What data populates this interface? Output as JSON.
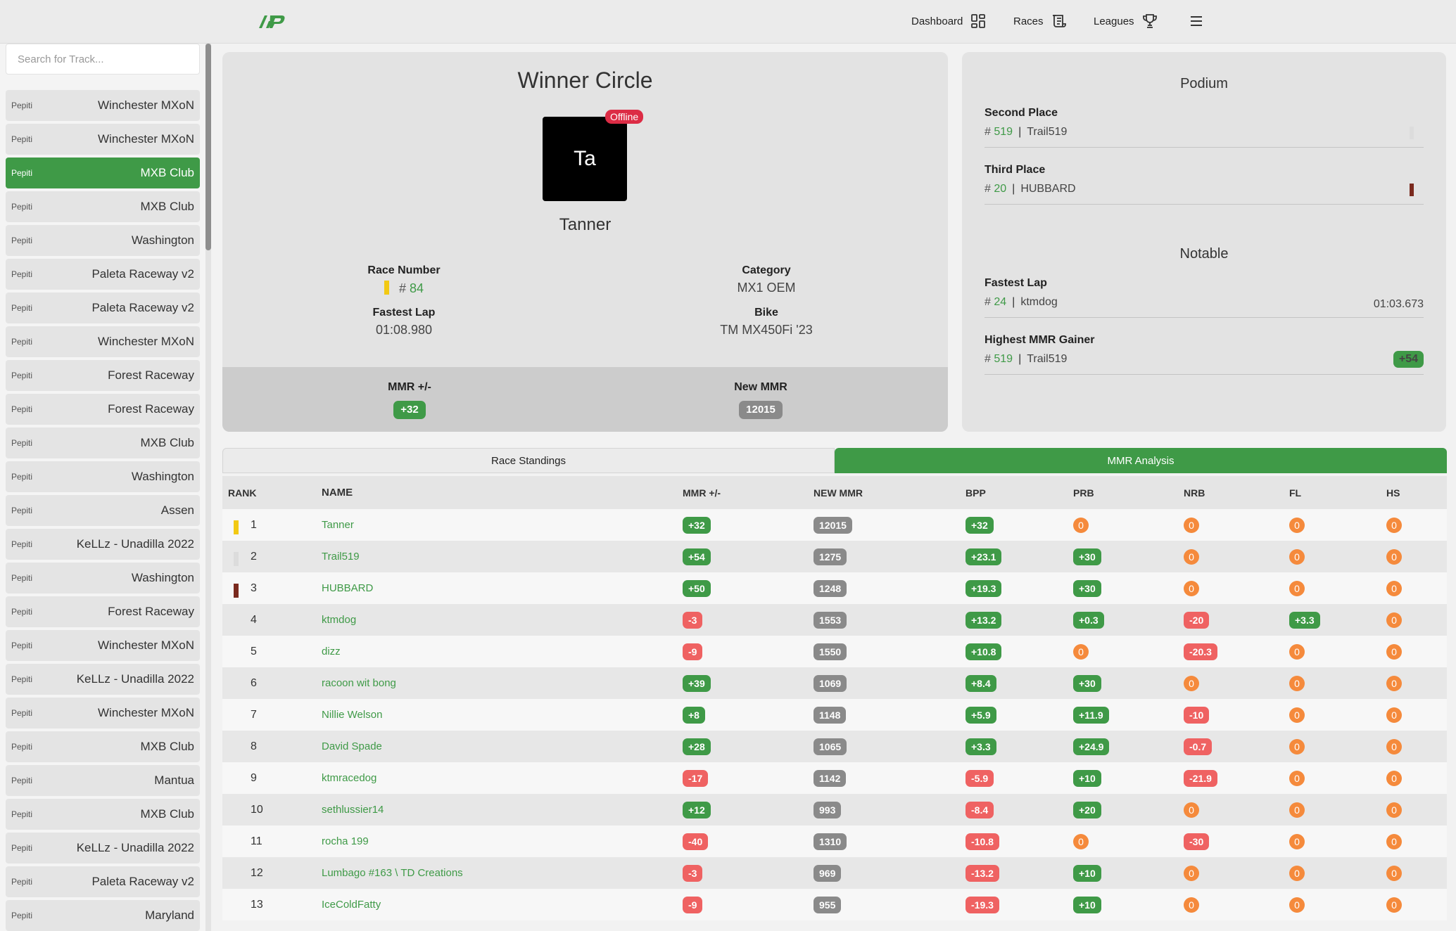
{
  "nav": {
    "dashboard": "Dashboard",
    "races": "Races",
    "leagues": "Leagues"
  },
  "sidebar": {
    "search_placeholder": "Search for Track...",
    "items": [
      {
        "tag": "Pepiti",
        "name": "Winchester MXoN",
        "active": false
      },
      {
        "tag": "Pepiti",
        "name": "Winchester MXoN",
        "active": false
      },
      {
        "tag": "Pepiti",
        "name": "MXB Club",
        "active": true
      },
      {
        "tag": "Pepiti",
        "name": "MXB Club",
        "active": false
      },
      {
        "tag": "Pepiti",
        "name": "Washington",
        "active": false
      },
      {
        "tag": "Pepiti",
        "name": "Paleta Raceway v2",
        "active": false
      },
      {
        "tag": "Pepiti",
        "name": "Paleta Raceway v2",
        "active": false
      },
      {
        "tag": "Pepiti",
        "name": "Winchester MXoN",
        "active": false
      },
      {
        "tag": "Pepiti",
        "name": "Forest Raceway",
        "active": false
      },
      {
        "tag": "Pepiti",
        "name": "Forest Raceway",
        "active": false
      },
      {
        "tag": "Pepiti",
        "name": "MXB Club",
        "active": false
      },
      {
        "tag": "Pepiti",
        "name": "Washington",
        "active": false
      },
      {
        "tag": "Pepiti",
        "name": "Assen",
        "active": false
      },
      {
        "tag": "Pepiti",
        "name": "KeLLz - Unadilla 2022",
        "active": false
      },
      {
        "tag": "Pepiti",
        "name": "Washington",
        "active": false
      },
      {
        "tag": "Pepiti",
        "name": "Forest Raceway",
        "active": false
      },
      {
        "tag": "Pepiti",
        "name": "Winchester MXoN",
        "active": false
      },
      {
        "tag": "Pepiti",
        "name": "KeLLz - Unadilla 2022",
        "active": false
      },
      {
        "tag": "Pepiti",
        "name": "Winchester MXoN",
        "active": false
      },
      {
        "tag": "Pepiti",
        "name": "MXB Club",
        "active": false
      },
      {
        "tag": "Pepiti",
        "name": "Mantua",
        "active": false
      },
      {
        "tag": "Pepiti",
        "name": "MXB Club",
        "active": false
      },
      {
        "tag": "Pepiti",
        "name": "KeLLz - Unadilla 2022",
        "active": false
      },
      {
        "tag": "Pepiti",
        "name": "Paleta Raceway v2",
        "active": false
      },
      {
        "tag": "Pepiti",
        "name": "Maryland",
        "active": false
      }
    ]
  },
  "winner": {
    "title": "Winner Circle",
    "avatar": "Ta",
    "status": "Offline",
    "name": "Tanner",
    "race_number_label": "Race Number",
    "race_number": "84",
    "category_label": "Category",
    "category": "MX1 OEM",
    "fastest_lap_label": "Fastest Lap",
    "fastest_lap": "01:08.980",
    "bike_label": "Bike",
    "bike": "TM MX450Fi '23",
    "mmr_change_label": "MMR +/-",
    "mmr_change": "+32",
    "new_mmr_label": "New MMR",
    "new_mmr": "12015"
  },
  "podium": {
    "title": "Podium",
    "second_label": "Second Place",
    "second_number": "519",
    "second_name": "Trail519",
    "third_label": "Third Place",
    "third_number": "20",
    "third_name": "HUBBARD",
    "notable_title": "Notable",
    "fastest_lap_label": "Fastest Lap",
    "fastest_lap_number": "24",
    "fastest_lap_name": "ktmdog",
    "fastest_lap_time": "01:03.673",
    "mmr_gainer_label": "Highest MMR Gainer",
    "mmr_gainer_number": "519",
    "mmr_gainer_name": "Trail519",
    "mmr_gainer_value": "+54"
  },
  "tabs": {
    "standings": "Race Standings",
    "analysis": "MMR Analysis"
  },
  "table": {
    "headers": {
      "rank": "RANK",
      "name": "NAME",
      "mmr": "MMR +/-",
      "new_mmr": "NEW MMR",
      "bpp": "BPP",
      "prb": "PRB",
      "nrb": "NRB",
      "fl": "FL",
      "hs": "HS"
    },
    "rows": [
      {
        "rank": "1",
        "name": "Tanner",
        "mmr": "+32",
        "new_mmr": "12015",
        "bpp": "+32",
        "prb": "0",
        "nrb": "0",
        "fl": "0",
        "hs": "0",
        "mark": "gold"
      },
      {
        "rank": "2",
        "name": "Trail519",
        "mmr": "+54",
        "new_mmr": "1275",
        "bpp": "+23.1",
        "prb": "+30",
        "nrb": "0",
        "fl": "0",
        "hs": "0",
        "mark": "silver"
      },
      {
        "rank": "3",
        "name": "HUBBARD",
        "mmr": "+50",
        "new_mmr": "1248",
        "bpp": "+19.3",
        "prb": "+30",
        "nrb": "0",
        "fl": "0",
        "hs": "0",
        "mark": "bronze"
      },
      {
        "rank": "4",
        "name": "ktmdog",
        "mmr": "-3",
        "new_mmr": "1553",
        "bpp": "+13.2",
        "prb": "+0.3",
        "nrb": "-20",
        "fl": "+3.3",
        "hs": "0",
        "mark": ""
      },
      {
        "rank": "5",
        "name": "dizz",
        "mmr": "-9",
        "new_mmr": "1550",
        "bpp": "+10.8",
        "prb": "0",
        "nrb": "-20.3",
        "fl": "0",
        "hs": "0",
        "mark": ""
      },
      {
        "rank": "6",
        "name": "racoon wit bong",
        "mmr": "+39",
        "new_mmr": "1069",
        "bpp": "+8.4",
        "prb": "+30",
        "nrb": "0",
        "fl": "0",
        "hs": "0",
        "mark": ""
      },
      {
        "rank": "7",
        "name": "Nillie Welson",
        "mmr": "+8",
        "new_mmr": "1148",
        "bpp": "+5.9",
        "prb": "+11.9",
        "nrb": "-10",
        "fl": "0",
        "hs": "0",
        "mark": ""
      },
      {
        "rank": "8",
        "name": "David Spade",
        "mmr": "+28",
        "new_mmr": "1065",
        "bpp": "+3.3",
        "prb": "+24.9",
        "nrb": "-0.7",
        "fl": "0",
        "hs": "0",
        "mark": ""
      },
      {
        "rank": "9",
        "name": "ktmracedog",
        "mmr": "-17",
        "new_mmr": "1142",
        "bpp": "-5.9",
        "prb": "+10",
        "nrb": "-21.9",
        "fl": "0",
        "hs": "0",
        "mark": ""
      },
      {
        "rank": "10",
        "name": "sethlussier14",
        "mmr": "+12",
        "new_mmr": "993",
        "bpp": "-8.4",
        "prb": "+20",
        "nrb": "0",
        "fl": "0",
        "hs": "0",
        "mark": ""
      },
      {
        "rank": "11",
        "name": "rocha 199",
        "mmr": "-40",
        "new_mmr": "1310",
        "bpp": "-10.8",
        "prb": "0",
        "nrb": "-30",
        "fl": "0",
        "hs": "0",
        "mark": ""
      },
      {
        "rank": "12",
        "name": "Lumbago #163 \\ TD Creations",
        "mmr": "-3",
        "new_mmr": "969",
        "bpp": "-13.2",
        "prb": "+10",
        "nrb": "0",
        "fl": "0",
        "hs": "0",
        "mark": ""
      },
      {
        "rank": "13",
        "name": "IceColdFatty",
        "mmr": "-9",
        "new_mmr": "955",
        "bpp": "-19.3",
        "prb": "+10",
        "nrb": "0",
        "fl": "0",
        "hs": "0",
        "mark": ""
      }
    ]
  },
  "colors": {
    "accent": "#3f9a47",
    "negative": "#ef6262",
    "zero": "#f58a3c",
    "neutral": "#8a8a8a",
    "offline": "#dc2c45",
    "gold": "#f2c913",
    "silver": "#dcdcdc",
    "bronze": "#7a2a1e"
  }
}
